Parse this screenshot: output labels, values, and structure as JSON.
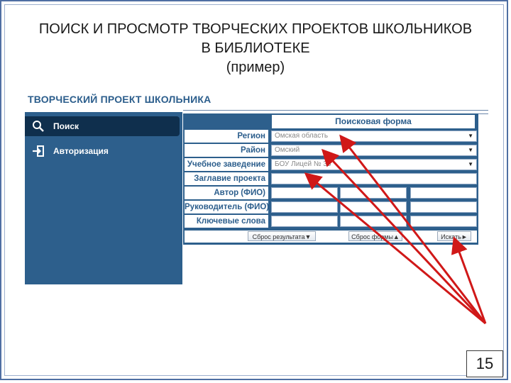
{
  "slide": {
    "title_line1": "ПОИСК И ПРОСМОТР ТВОРЧЕСКИХ ПРОЕКТОВ ШКОЛЬНИКОВ",
    "title_line2": "В БИБЛИОТЕКЕ",
    "title_line3": "(пример)",
    "page_number": "15"
  },
  "site": {
    "title": "ТВОРЧЕСКИЙ ПРОЕКТ ШКОЛЬНИКА"
  },
  "sidebar": {
    "items": [
      {
        "label": "Поиск",
        "icon": "search-icon",
        "active": true
      },
      {
        "label": "Авторизация",
        "icon": "login-icon",
        "active": false
      }
    ]
  },
  "search_form": {
    "header": "Поисковая форма",
    "fields": {
      "region": {
        "label": "Регион",
        "value": "Омская область"
      },
      "district": {
        "label": "Район",
        "value": "Омский"
      },
      "institution": {
        "label": "Учебное заведение",
        "value": "БОУ Лицей № 35"
      },
      "project_title": {
        "label": "Заглавие проекта",
        "value": ""
      },
      "author": {
        "label": "Автор (ФИО)"
      },
      "supervisor": {
        "label": "Руководитель (ФИО)"
      },
      "keywords": {
        "label": "Ключевые слова"
      }
    },
    "buttons": {
      "reset_results": "Сброс результата▼",
      "reset_form": "Сброс формы▲",
      "search": "Искать►"
    }
  },
  "colors": {
    "brand_blue": "#2d5f8c",
    "active_item": "#0f2f4d",
    "annotation_arrow": "#d01818"
  }
}
